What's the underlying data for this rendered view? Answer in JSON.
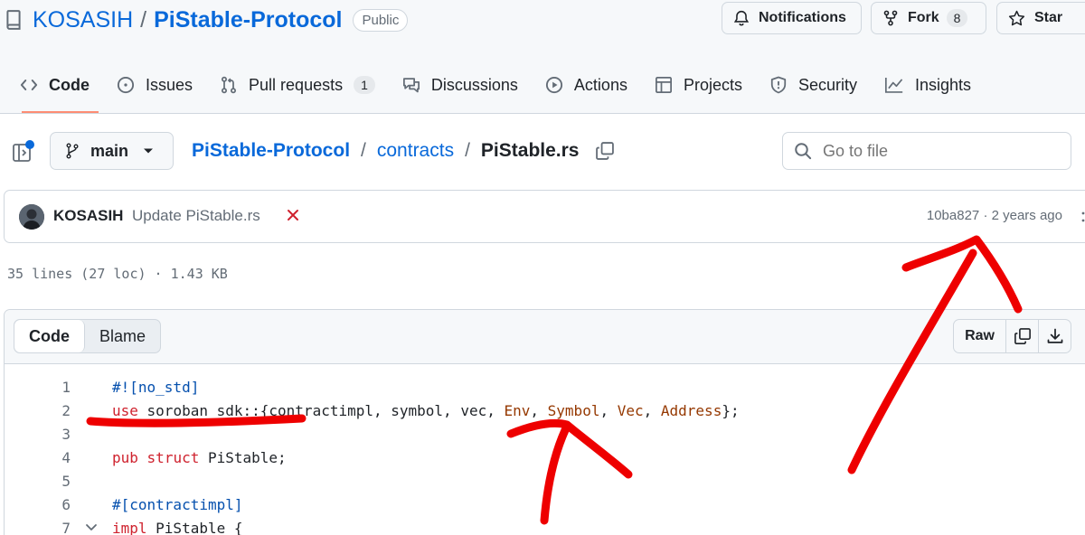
{
  "repo": {
    "owner": "KOSASIH",
    "separator": "/",
    "name": "PiStable-Protocol",
    "visibility": "Public"
  },
  "header_buttons": {
    "notifications": "Notifications",
    "fork": "Fork",
    "fork_count": "8",
    "star": "Star"
  },
  "tabs": [
    {
      "label": "Code",
      "icon": "code-icon",
      "active": true
    },
    {
      "label": "Issues",
      "icon": "issue-icon"
    },
    {
      "label": "Pull requests",
      "icon": "pull-request-icon",
      "count": "1"
    },
    {
      "label": "Discussions",
      "icon": "discussion-icon"
    },
    {
      "label": "Actions",
      "icon": "play-icon"
    },
    {
      "label": "Projects",
      "icon": "table-icon"
    },
    {
      "label": "Security",
      "icon": "shield-icon"
    },
    {
      "label": "Insights",
      "icon": "graph-icon"
    }
  ],
  "branch": {
    "name": "main"
  },
  "breadcrumb": {
    "repo": "PiStable-Protocol",
    "sep": "/",
    "folder": "contracts",
    "file": "PiStable.rs"
  },
  "search": {
    "placeholder": "Go to file"
  },
  "commit": {
    "author": "KOSASIH",
    "message": "Update PiStable.rs",
    "status": "failed",
    "meta": "10ba827 · 2 years ago"
  },
  "file_info": "35 lines (27 loc) · 1.43 KB",
  "viewer": {
    "code_tab": "Code",
    "blame_tab": "Blame",
    "raw_label": "Raw"
  },
  "code_lines": [
    {
      "num": "1",
      "text": "#![no_std]"
    },
    {
      "num": "2",
      "text": "use soroban_sdk::{contractimpl, symbol, vec, Env, Symbol, Vec, Address};"
    },
    {
      "num": "3",
      "text": ""
    },
    {
      "num": "4",
      "text": "pub struct PiStable;"
    },
    {
      "num": "5",
      "text": ""
    },
    {
      "num": "6",
      "text": "#[contractimpl]"
    },
    {
      "num": "7",
      "text": "impl PiStable {",
      "foldable": true
    }
  ],
  "colors": {
    "link": "#0969da",
    "keyword": "#cf222e",
    "type": "#953800",
    "attribute": "#0550ae",
    "annotation": "#ee0000",
    "active_tab_underline": "#fd8c73"
  }
}
